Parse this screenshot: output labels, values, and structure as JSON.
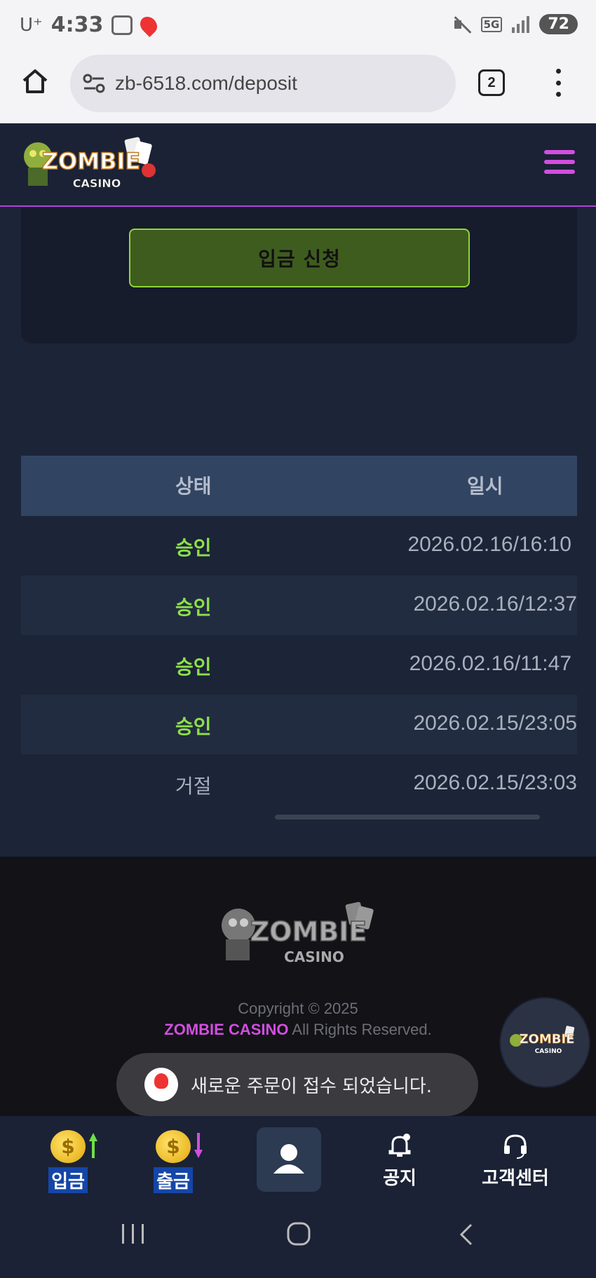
{
  "status_bar": {
    "carrier": "U⁺",
    "time": "4:33",
    "network": "5G",
    "battery": "72"
  },
  "browser": {
    "url": "zb-6518.com/deposit",
    "tab_count": "2"
  },
  "site": {
    "brand_top": "ZOMBIE",
    "brand_bottom": "CASINO",
    "accent_color": "#d24ee0"
  },
  "deposit": {
    "submit_label": "입금 신청"
  },
  "history": {
    "columns": [
      "상태",
      "일시"
    ],
    "rows": [
      {
        "status": "승인",
        "datetime": "2026.02.16/16:10"
      },
      {
        "status": "승인",
        "datetime": "2026.02.16/12:37"
      },
      {
        "status": "승인",
        "datetime": "2026.02.16/11:47"
      },
      {
        "status": "승인",
        "datetime": "2026.02.15/23:05"
      },
      {
        "status": "거절",
        "datetime": "2026.02.15/23:03"
      }
    ]
  },
  "footer": {
    "copyright": "Copyright © 2025",
    "brand": "ZOMBIE CASINO",
    "rights": " All Rights Reserved."
  },
  "toast": {
    "message": "새로운 주문이 접수 되었습니다."
  },
  "bottom_nav": {
    "deposit": "입금",
    "withdraw": "출금",
    "notice": "공지",
    "support": "고객센터"
  }
}
